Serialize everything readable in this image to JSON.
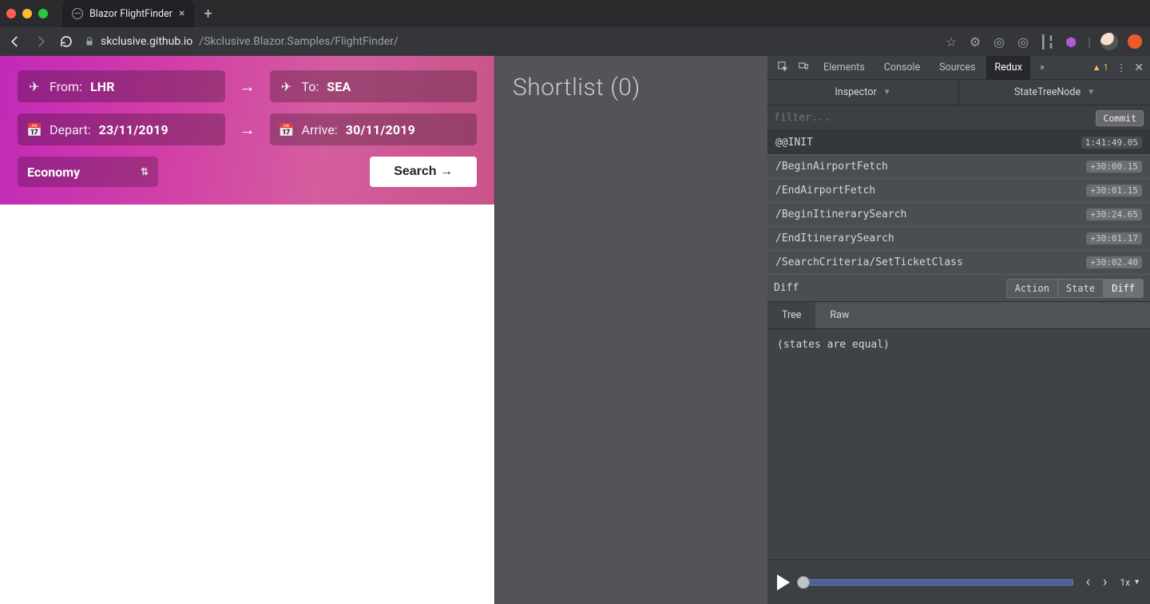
{
  "browser": {
    "tab_title": "Blazor FlightFinder",
    "url_host": "skclusive.github.io",
    "url_path": "/Skclusive.Blazor.Samples/FlightFinder/"
  },
  "search_panel": {
    "from_label": "From:",
    "from_value": "LHR",
    "to_label": "To:",
    "to_value": "SEA",
    "depart_label": "Depart:",
    "depart_value": "23/11/2019",
    "arrive_label": "Arrive:",
    "arrive_value": "30/11/2019",
    "class_value": "Economy",
    "search_button": "Search →"
  },
  "shortlist": {
    "title": "Shortlist (0)"
  },
  "devtools": {
    "tabs": {
      "elements": "Elements",
      "console": "Console",
      "sources": "Sources",
      "redux": "Redux"
    },
    "warn_count": "1",
    "inspector_left": "Inspector",
    "inspector_right": "StateTreeNode",
    "filter_placeholder": "filter...",
    "commit_label": "Commit",
    "actions": [
      {
        "name": "@@INIT",
        "time": "1:41:49.05",
        "selected": true
      },
      {
        "name": "/BeginAirportFetch",
        "time": "+30:00.15",
        "selected": false
      },
      {
        "name": "/EndAirportFetch",
        "time": "+30:01.15",
        "selected": false
      },
      {
        "name": "/BeginItinerarySearch",
        "time": "+30:24.65",
        "selected": false
      },
      {
        "name": "/EndItinerarySearch",
        "time": "+30:01.17",
        "selected": false
      },
      {
        "name": "/SearchCriteria/SetTicketClass",
        "time": "+30:02.40",
        "selected": false
      }
    ],
    "diff_label": "Diff",
    "seg_action": "Action",
    "seg_state": "State",
    "seg_diff": "Diff",
    "tree_tab": "Tree",
    "raw_tab": "Raw",
    "diff_body": "(states are equal)",
    "speed": "1x"
  }
}
